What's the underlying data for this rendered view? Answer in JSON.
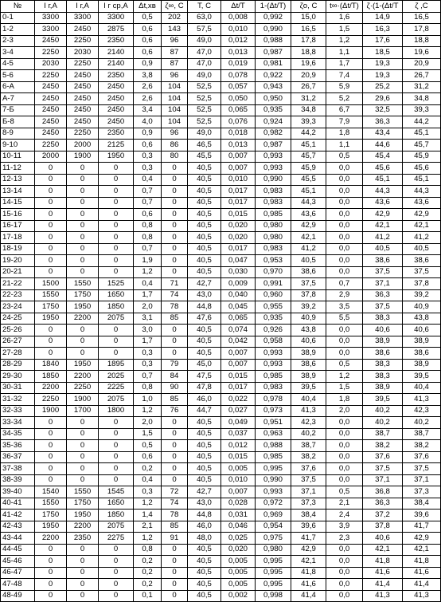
{
  "headers": [
    "№",
    "I г,А",
    "I г,А",
    "I г ср,А",
    "Δt,хв",
    "ζ∞, С",
    "T, С",
    "Δt/T",
    "1-(Δt/T)",
    "ζо, С",
    "t∞·(Δt/T)",
    "ζ·(1-(Δt/T",
    "ζ ,С"
  ],
  "rows": [
    [
      "0-1",
      "3300",
      "3300",
      "3300",
      "0,5",
      "202",
      "63,0",
      "0,008",
      "0,992",
      "15,0",
      "1,6",
      "14,9",
      "16,5"
    ],
    [
      "1-2",
      "3300",
      "2450",
      "2875",
      "0,6",
      "143",
      "57,5",
      "0,010",
      "0,990",
      "16,5",
      "1,5",
      "16,3",
      "17,8"
    ],
    [
      "2-3",
      "2450",
      "2250",
      "2350",
      "0,6",
      "96",
      "49,0",
      "0,012",
      "0,988",
      "17,8",
      "1,2",
      "17,6",
      "18,8"
    ],
    [
      "3-4",
      "2250",
      "2030",
      "2140",
      "0,6",
      "87",
      "47,0",
      "0,013",
      "0,987",
      "18,8",
      "1,1",
      "18,5",
      "19,6"
    ],
    [
      "4-5",
      "2030",
      "2250",
      "2140",
      "0,9",
      "87",
      "47,0",
      "0,019",
      "0,981",
      "19,6",
      "1,7",
      "19,3",
      "20,9"
    ],
    [
      "5-6",
      "2250",
      "2450",
      "2350",
      "3,8",
      "96",
      "49,0",
      "0,078",
      "0,922",
      "20,9",
      "7,4",
      "19,3",
      "26,7"
    ],
    [
      "6-А",
      "2450",
      "2450",
      "2450",
      "2,6",
      "104",
      "52,5",
      "0,057",
      "0,943",
      "26,7",
      "5,9",
      "25,2",
      "31,2"
    ],
    [
      "А-7",
      "2450",
      "2450",
      "2450",
      "2,6",
      "104",
      "52,5",
      "0,050",
      "0,950",
      "31,2",
      "5,2",
      "29,6",
      "34,8"
    ],
    [
      "7-Б",
      "2450",
      "2450",
      "2450",
      "3,4",
      "104",
      "52,5",
      "0,065",
      "0,935",
      "34,8",
      "6,7",
      "32,5",
      "39,3"
    ],
    [
      "Б-8",
      "2450",
      "2450",
      "2450",
      "4,0",
      "104",
      "52,5",
      "0,076",
      "0,924",
      "39,3",
      "7,9",
      "36,3",
      "44,2"
    ],
    [
      "8-9",
      "2450",
      "2250",
      "2350",
      "0,9",
      "96",
      "49,0",
      "0,018",
      "0,982",
      "44,2",
      "1,8",
      "43,4",
      "45,1"
    ],
    [
      "9-10",
      "2250",
      "2000",
      "2125",
      "0,6",
      "86",
      "46,5",
      "0,013",
      "0,987",
      "45,1",
      "1,1",
      "44,6",
      "45,7"
    ],
    [
      "10-11",
      "2000",
      "1900",
      "1950",
      "0,3",
      "80",
      "45,5",
      "0,007",
      "0,993",
      "45,7",
      "0,5",
      "45,4",
      "45,9"
    ],
    [
      "11-12",
      "0",
      "0",
      "0",
      "0,3",
      "0",
      "40,5",
      "0,007",
      "0,993",
      "45,9",
      "0,0",
      "45,6",
      "45,6"
    ],
    [
      "12-13",
      "0",
      "0",
      "0",
      "0,4",
      "0",
      "40,5",
      "0,010",
      "0,990",
      "45,5",
      "0,0",
      "45,1",
      "45,1"
    ],
    [
      "13-14",
      "0",
      "0",
      "0",
      "0,7",
      "0",
      "40,5",
      "0,017",
      "0,983",
      "45,1",
      "0,0",
      "44,3",
      "44,3"
    ],
    [
      "14-15",
      "0",
      "0",
      "0",
      "0,7",
      "0",
      "40,5",
      "0,017",
      "0,983",
      "44,3",
      "0,0",
      "43,6",
      "43,6"
    ],
    [
      "15-16",
      "0",
      "0",
      "0",
      "0,6",
      "0",
      "40,5",
      "0,015",
      "0,985",
      "43,6",
      "0,0",
      "42,9",
      "42,9"
    ],
    [
      "16-17",
      "0",
      "0",
      "0",
      "0,8",
      "0",
      "40,5",
      "0,020",
      "0,980",
      "42,9",
      "0,0",
      "42,1",
      "42,1"
    ],
    [
      "17-18",
      "0",
      "0",
      "0",
      "0,8",
      "0",
      "40,5",
      "0,020",
      "0,980",
      "42,1",
      "0,0",
      "41,2",
      "41,2"
    ],
    [
      "18-19",
      "0",
      "0",
      "0",
      "0,7",
      "0",
      "40,5",
      "0,017",
      "0,983",
      "41,2",
      "0,0",
      "40,5",
      "40,5"
    ],
    [
      "19-20",
      "0",
      "0",
      "0",
      "1,9",
      "0",
      "40,5",
      "0,047",
      "0,953",
      "40,5",
      "0,0",
      "38,6",
      "38,6"
    ],
    [
      "20-21",
      "0",
      "0",
      "0",
      "1,2",
      "0",
      "40,5",
      "0,030",
      "0,970",
      "38,6",
      "0,0",
      "37,5",
      "37,5"
    ],
    [
      "21-22",
      "1500",
      "1550",
      "1525",
      "0,4",
      "71",
      "42,7",
      "0,009",
      "0,991",
      "37,5",
      "0,7",
      "37,1",
      "37,8"
    ],
    [
      "22-23",
      "1550",
      "1750",
      "1650",
      "1,7",
      "74",
      "43,0",
      "0,040",
      "0,960",
      "37,8",
      "2,9",
      "36,3",
      "39,2"
    ],
    [
      "23-24",
      "1750",
      "1950",
      "1850",
      "2,0",
      "78",
      "44,8",
      "0,045",
      "0,955",
      "39,2",
      "3,5",
      "37,5",
      "40,9"
    ],
    [
      "24-25",
      "1950",
      "2200",
      "2075",
      "3,1",
      "85",
      "47,6",
      "0,065",
      "0,935",
      "40,9",
      "5,5",
      "38,3",
      "43,8"
    ],
    [
      "25-26",
      "0",
      "0",
      "0",
      "3,0",
      "0",
      "40,5",
      "0,074",
      "0,926",
      "43,8",
      "0,0",
      "40,6",
      "40,6"
    ],
    [
      "26-27",
      "0",
      "0",
      "0",
      "1,7",
      "0",
      "40,5",
      "0,042",
      "0,958",
      "40,6",
      "0,0",
      "38,9",
      "38,9"
    ],
    [
      "27-28",
      "0",
      "0",
      "0",
      "0,3",
      "0",
      "40,5",
      "0,007",
      "0,993",
      "38,9",
      "0,0",
      "38,6",
      "38,6"
    ],
    [
      "28-29",
      "1840",
      "1950",
      "1895",
      "0,3",
      "79",
      "45,0",
      "0,007",
      "0,993",
      "38,6",
      "0,5",
      "38,3",
      "38,9"
    ],
    [
      "29-30",
      "1850",
      "2200",
      "2025",
      "0,7",
      "84",
      "47,5",
      "0,015",
      "0,985",
      "38,9",
      "1,2",
      "38,3",
      "39,5"
    ],
    [
      "30-31",
      "2200",
      "2250",
      "2225",
      "0,8",
      "90",
      "47,8",
      "0,017",
      "0,983",
      "39,5",
      "1,5",
      "38,9",
      "40,4"
    ],
    [
      "31-32",
      "2250",
      "1900",
      "2075",
      "1,0",
      "85",
      "46,0",
      "0,022",
      "0,978",
      "40,4",
      "1,8",
      "39,5",
      "41,3"
    ],
    [
      "32-33",
      "1900",
      "1700",
      "1800",
      "1,2",
      "76",
      "44,7",
      "0,027",
      "0,973",
      "41,3",
      "2,0",
      "40,2",
      "42,3"
    ],
    [
      "33-34",
      "0",
      "0",
      "0",
      "2,0",
      "0",
      "40,5",
      "0,049",
      "0,951",
      "42,3",
      "0,0",
      "40,2",
      "40,2"
    ],
    [
      "34-35",
      "0",
      "0",
      "0",
      "1,5",
      "0",
      "40,5",
      "0,037",
      "0,963",
      "40,2",
      "0,0",
      "38,7",
      "38,7"
    ],
    [
      "35-36",
      "0",
      "0",
      "0",
      "0,5",
      "0",
      "40,5",
      "0,012",
      "0,988",
      "38,7",
      "0,0",
      "38,2",
      "38,2"
    ],
    [
      "36-37",
      "0",
      "0",
      "0",
      "0,6",
      "0",
      "40,5",
      "0,015",
      "0,985",
      "38,2",
      "0,0",
      "37,6",
      "37,6"
    ],
    [
      "37-38",
      "0",
      "0",
      "0",
      "0,2",
      "0",
      "40,5",
      "0,005",
      "0,995",
      "37,6",
      "0,0",
      "37,5",
      "37,5"
    ],
    [
      "38-39",
      "0",
      "0",
      "0",
      "0,4",
      "0",
      "40,5",
      "0,010",
      "0,990",
      "37,5",
      "0,0",
      "37,1",
      "37,1"
    ],
    [
      "39-40",
      "1540",
      "1550",
      "1545",
      "0,3",
      "72",
      "42,7",
      "0,007",
      "0,993",
      "37,1",
      "0,5",
      "36,8",
      "37,3"
    ],
    [
      "40-41",
      "1550",
      "1750",
      "1650",
      "1,2",
      "74",
      "43,0",
      "0,028",
      "0,972",
      "37,3",
      "2,1",
      "36,3",
      "38,4"
    ],
    [
      "41-42",
      "1750",
      "1950",
      "1850",
      "1,4",
      "78",
      "44,8",
      "0,031",
      "0,969",
      "38,4",
      "2,4",
      "37,2",
      "39,6"
    ],
    [
      "42-43",
      "1950",
      "2200",
      "2075",
      "2,1",
      "85",
      "46,0",
      "0,046",
      "0,954",
      "39,6",
      "3,9",
      "37,8",
      "41,7"
    ],
    [
      "43-44",
      "2200",
      "2350",
      "2275",
      "1,2",
      "91",
      "48,0",
      "0,025",
      "0,975",
      "41,7",
      "2,3",
      "40,6",
      "42,9"
    ],
    [
      "44-45",
      "0",
      "0",
      "0",
      "0,8",
      "0",
      "40,5",
      "0,020",
      "0,980",
      "42,9",
      "0,0",
      "42,1",
      "42,1"
    ],
    [
      "45-46",
      "0",
      "0",
      "0",
      "0,2",
      "0",
      "40,5",
      "0,005",
      "0,995",
      "42,1",
      "0,0",
      "41,8",
      "41,8"
    ],
    [
      "46-47",
      "0",
      "0",
      "0",
      "0,2",
      "0",
      "40,5",
      "0,005",
      "0,995",
      "41,8",
      "0,0",
      "41,6",
      "41,6"
    ],
    [
      "47-48",
      "0",
      "0",
      "0",
      "0,2",
      "0",
      "40,5",
      "0,005",
      "0,995",
      "41,6",
      "0,0",
      "41,4",
      "41,4"
    ],
    [
      "48-49",
      "0",
      "0",
      "0",
      "0,1",
      "0",
      "40,5",
      "0,002",
      "0,998",
      "41,4",
      "0,0",
      "41,3",
      "41,3"
    ]
  ]
}
